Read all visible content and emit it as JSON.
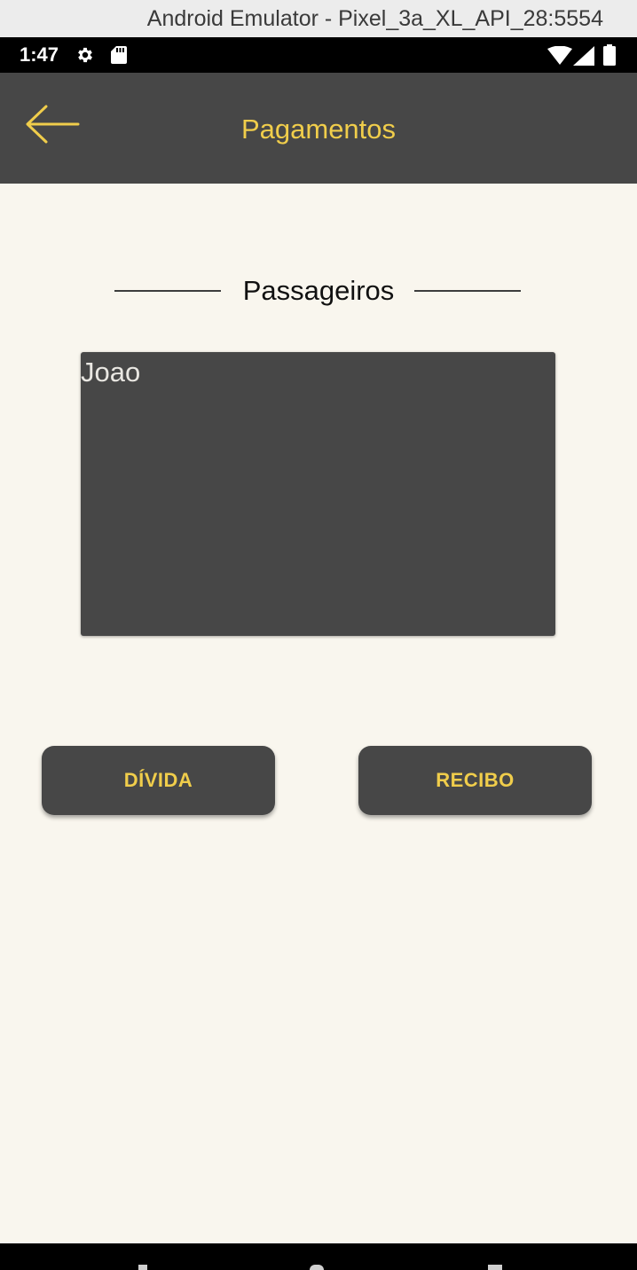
{
  "window": {
    "title": "Android Emulator - Pixel_3a_XL_API_28:5554"
  },
  "status_bar": {
    "time": "1:47",
    "icons": [
      "gear-icon",
      "sd-card-icon",
      "wifi-icon",
      "signal-icon",
      "battery-icon"
    ]
  },
  "app_bar": {
    "title": "Pagamentos",
    "back_icon": "arrow-back-icon"
  },
  "section": {
    "heading": "Passageiros"
  },
  "passengers": [
    {
      "name": "Joao"
    }
  ],
  "buttons": {
    "divida_label": "DÍVIDA",
    "recibo_label": "RECIBO"
  },
  "colors": {
    "background": "#f9f6ee",
    "surface": "#474747",
    "accent": "#f0cd4b",
    "text_light": "#e9e7e2"
  }
}
